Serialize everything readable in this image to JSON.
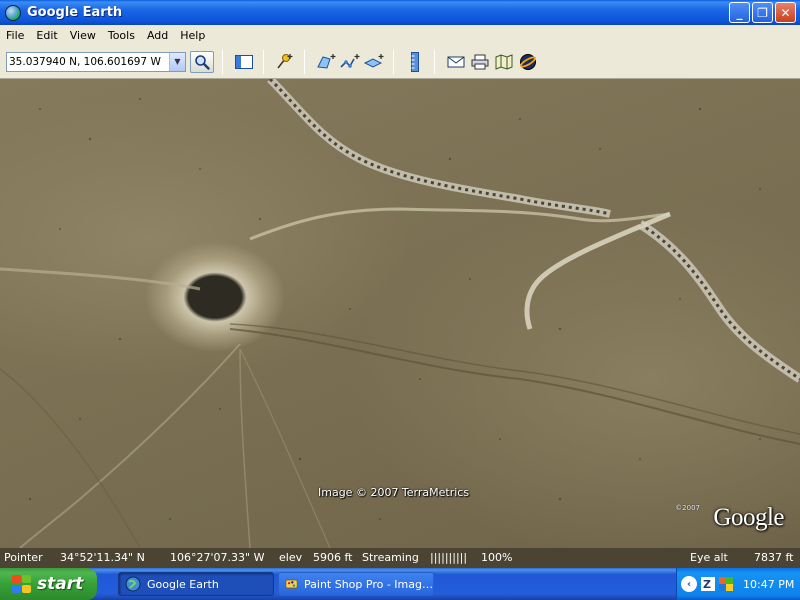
{
  "window": {
    "title": "Google Earth",
    "controls": {
      "minimize": "_",
      "maximize": "❐",
      "close": "✕"
    }
  },
  "menu": {
    "items": [
      "File",
      "Edit",
      "View",
      "Tools",
      "Add",
      "Help"
    ]
  },
  "toolbar": {
    "search_value": "35.037940 N, 106.601697 W",
    "icons": [
      "search-icon",
      "sidebar-toggle-icon",
      "placemark-icon",
      "polygon-icon",
      "path-icon",
      "overlay-icon",
      "ruler-icon",
      "email-icon",
      "print-icon",
      "google-maps-icon",
      "sky-icon"
    ]
  },
  "map": {
    "imagery_credit": "Image © 2007 TerraMetrics",
    "logo_text": "Google",
    "logo_copyright": "©2007"
  },
  "status": {
    "pointer_label": "Pointer",
    "latitude": "34°52'11.34\" N",
    "longitude": "106°27'07.33\" W",
    "elev_label": "elev",
    "elev_value": "5906 ft",
    "streaming_label": "Streaming",
    "streaming_bar": "||||||||||",
    "streaming_percent": "100%",
    "eye_alt_label": "Eye alt",
    "eye_alt_value": "7837 ft"
  },
  "taskbar": {
    "start_label": "start",
    "tasks": [
      {
        "label": "Google Earth",
        "active": true
      },
      {
        "label": "Paint Shop Pro - Imag…",
        "active": false
      }
    ],
    "clock": "10:47 PM"
  },
  "colors": {
    "titlebar": "#0d54d9",
    "taskbar": "#245edb",
    "start": "#37a137",
    "chrome": "#ece9d8"
  }
}
